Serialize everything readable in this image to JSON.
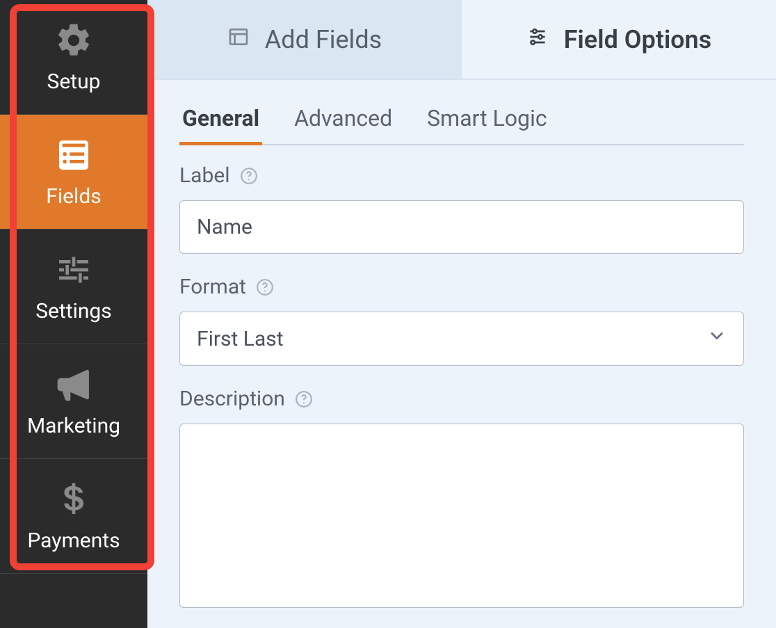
{
  "sidebar": {
    "items": [
      {
        "label": "Setup"
      },
      {
        "label": "Fields"
      },
      {
        "label": "Settings"
      },
      {
        "label": "Marketing"
      },
      {
        "label": "Payments"
      }
    ],
    "active_index": 1
  },
  "top_tabs": {
    "items": [
      {
        "label": "Add Fields"
      },
      {
        "label": "Field Options"
      }
    ],
    "active_index": 1
  },
  "sub_tabs": {
    "items": [
      {
        "label": "General"
      },
      {
        "label": "Advanced"
      },
      {
        "label": "Smart Logic"
      }
    ],
    "active_index": 0
  },
  "form": {
    "label_title": "Label",
    "label_value": "Name",
    "format_title": "Format",
    "format_value": "First Last",
    "description_title": "Description",
    "description_value": ""
  }
}
